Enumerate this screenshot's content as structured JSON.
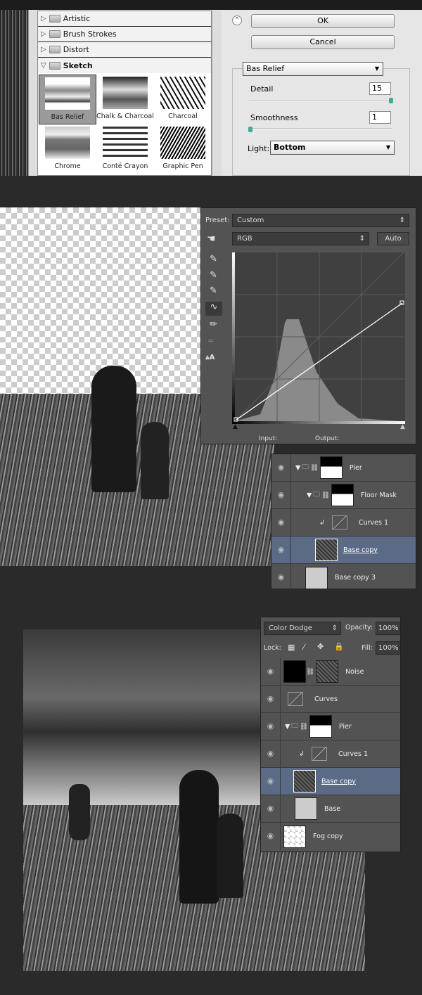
{
  "filter_gallery": {
    "categories": [
      {
        "label": "Artistic",
        "expanded": false
      },
      {
        "label": "Brush Strokes",
        "expanded": false
      },
      {
        "label": "Distort",
        "expanded": false
      },
      {
        "label": "Sketch",
        "expanded": true
      }
    ],
    "filters": [
      {
        "label": "Bas Relief",
        "selected": true
      },
      {
        "label": "Chalk & Charcoal"
      },
      {
        "label": "Charcoal"
      },
      {
        "label": "Chrome"
      },
      {
        "label": "Conté Crayon"
      },
      {
        "label": "Graphic Pen"
      }
    ],
    "ok_label": "OK",
    "cancel_label": "Cancel",
    "filter_select": "Bas Relief",
    "detail_label": "Detail",
    "detail_value": "15",
    "smoothness_label": "Smoothness",
    "smoothness_value": "1",
    "light_label": "Light:",
    "light_value": "Bottom"
  },
  "curves": {
    "preset_label": "Preset:",
    "preset_value": "Custom",
    "channel": "RGB",
    "auto_label": "Auto",
    "input_label": "Input:",
    "output_label": "Output:",
    "curve_points": [
      [
        0,
        0
      ],
      [
        255,
        180
      ]
    ]
  },
  "layers1": {
    "rows": [
      {
        "name": "Pier",
        "type": "group-mask"
      },
      {
        "name": "Floor Mask",
        "type": "group-mask"
      },
      {
        "name": "Curves 1",
        "type": "adjustment"
      },
      {
        "name": "Base copy",
        "type": "image",
        "active": true
      },
      {
        "name": "Base copy 3",
        "type": "image"
      }
    ]
  },
  "layers2": {
    "blend_mode": "Color Dodge",
    "opacity_label": "Opacity:",
    "opacity_value": "100%",
    "lock_label": "Lock:",
    "fill_label": "Fill:",
    "fill_value": "100%",
    "rows": [
      {
        "name": "Noise",
        "type": "masked"
      },
      {
        "name": "Curves",
        "type": "adjustment"
      },
      {
        "name": "Pier",
        "type": "group-mask"
      },
      {
        "name": "Curves 1",
        "type": "adjustment"
      },
      {
        "name": "Base copy",
        "type": "image",
        "active": true
      },
      {
        "name": "Base",
        "type": "image"
      },
      {
        "name": "Fog copy",
        "type": "image"
      }
    ]
  }
}
